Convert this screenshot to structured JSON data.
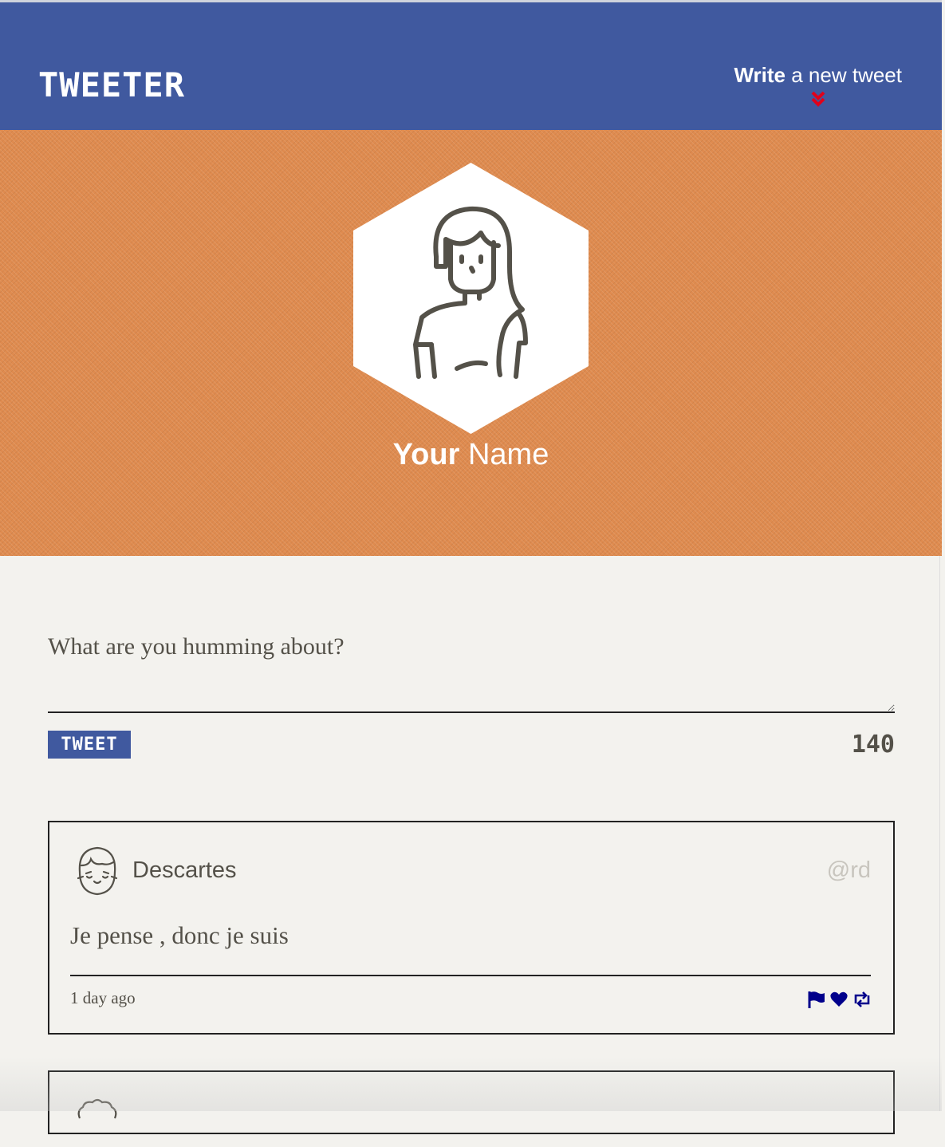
{
  "nav": {
    "brand": "TWEETER",
    "compose_bold": "Write",
    "compose_rest": " a new tweet",
    "colors": {
      "bar": "#40599f",
      "chevron": "#e0001b"
    }
  },
  "profile": {
    "first_name": "Your",
    "last_name": " Name",
    "avatar_icon": "woman-avatar-icon",
    "colors": {
      "background": "#df8b4f"
    }
  },
  "composer": {
    "placeholder": "What are you humming about?",
    "submit_label": "TWEET",
    "counter": "140"
  },
  "tweets": [
    {
      "name": "Descartes",
      "handle": "@rd",
      "text": "Je pense , donc je suis",
      "time": "1 day ago",
      "avatar_icon": "girl-avatar-icon",
      "actions": [
        "flag-icon",
        "heart-icon",
        "retweet-icon"
      ],
      "colors": {
        "actions": "#00008b"
      }
    }
  ]
}
